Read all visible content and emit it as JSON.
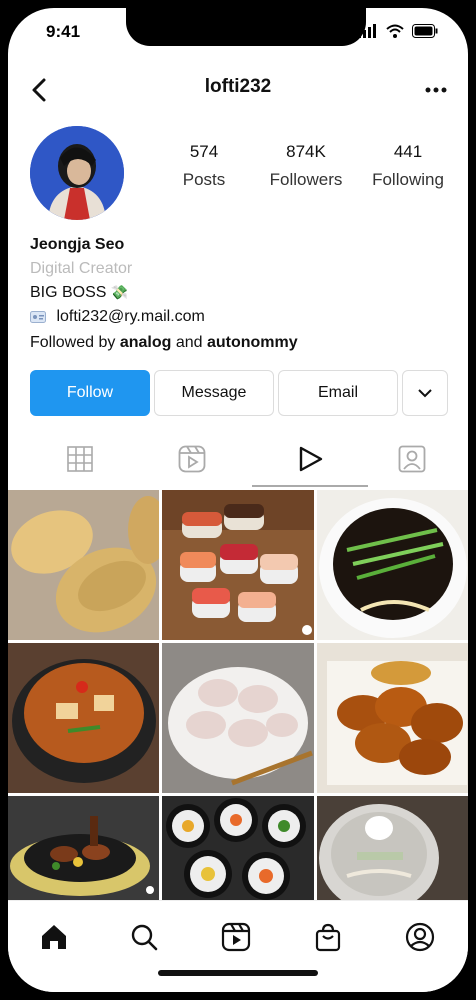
{
  "status": {
    "time": "9:41"
  },
  "header": {
    "username": "lofti232"
  },
  "stats": [
    {
      "value": "574",
      "label": "Posts"
    },
    {
      "value": "874K",
      "label": "Followers"
    },
    {
      "value": "441",
      "label": "Following"
    }
  ],
  "bio": {
    "name": "Jeongja Seo",
    "category": "Digital Creator",
    "tagline": "BIG BOSS",
    "email": "lofti232@ry.mail.com",
    "followed_prefix": "Followed by ",
    "followed_user1": "analog",
    "followed_and": " and ",
    "followed_user2": "autonommy"
  },
  "actions": {
    "follow": "Follow",
    "message": "Message",
    "email": "Email"
  },
  "tabs": [
    "grid-icon",
    "reels-icon",
    "play-icon",
    "tagged-icon"
  ],
  "colors": {
    "follow_blue": "#1f96f0",
    "avatar_bg": "#2f57c6"
  },
  "grid_items": [
    "fish-shaped pastries",
    "sushi platter",
    "black bean noodles",
    "stew in stone pot",
    "dumplings",
    "fried chicken",
    "grilled meat",
    "kimbap rolls",
    "cold noodles"
  ]
}
